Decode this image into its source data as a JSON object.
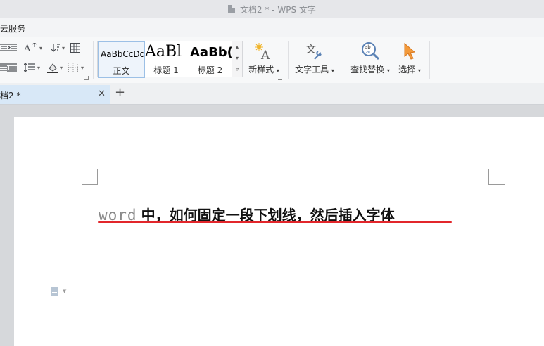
{
  "window": {
    "title": "文档2 * - WPS 文字"
  },
  "menubar": {
    "items": [
      {
        "label": "云服务"
      }
    ]
  },
  "ribbon": {
    "styles": [
      {
        "sample": "AaBbCcDd",
        "label": "正文",
        "selected": true
      },
      {
        "sample": "AaBl",
        "label": "标题 1",
        "selected": false
      },
      {
        "sample": "AaBb(",
        "label": "标题 2",
        "selected": false
      }
    ],
    "new_style_label": "新样式",
    "text_tools_label": "文字工具",
    "find_replace_label": "查找替换",
    "select_label": "选择"
  },
  "tabs": [
    {
      "label": "档2 *",
      "active": true
    }
  ],
  "document": {
    "heading_latin": "word",
    "heading_cjk": "中，如何固定一段下划线，然后插入字体",
    "underline_color": "#e2262b"
  },
  "colors": {
    "accent": "#9cc0e6",
    "underline": "#e2262b",
    "tab_active": "#d8e8f7"
  }
}
